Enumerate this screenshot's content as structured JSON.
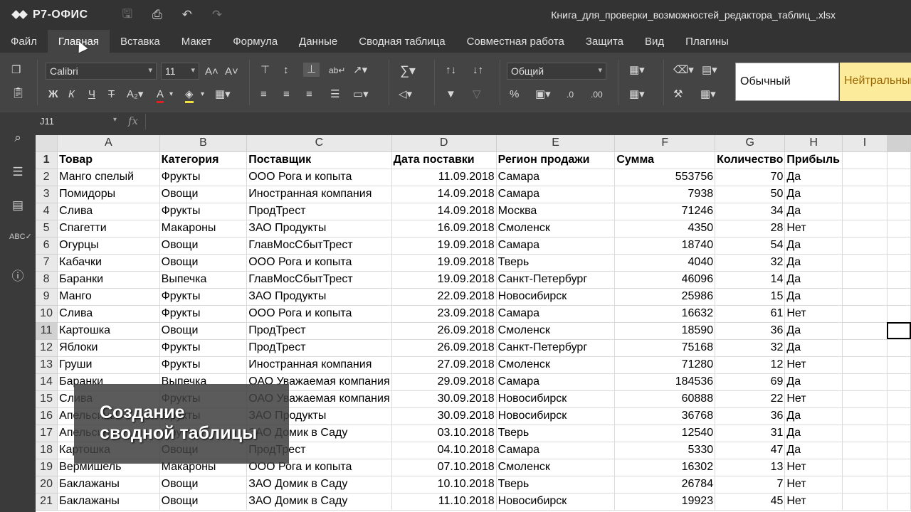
{
  "app": {
    "logo_text": "Р7-ОФИС",
    "document_title": "Книга_для_проверки_возможностей_редактора_таблиц_.xlsx"
  },
  "menu": [
    {
      "label": "Файл"
    },
    {
      "label": "Главная"
    },
    {
      "label": "Вставка"
    },
    {
      "label": "Макет"
    },
    {
      "label": "Формула"
    },
    {
      "label": "Данные"
    },
    {
      "label": "Сводная таблица"
    },
    {
      "label": "Совместная работа"
    },
    {
      "label": "Защита"
    },
    {
      "label": "Вид"
    },
    {
      "label": "Плагины"
    }
  ],
  "toolbar": {
    "font_name": "Calibri",
    "font_size": "11",
    "number_format": "Общий",
    "style_normal": "Обычный",
    "style_neutral": "Нейтральный"
  },
  "formula_bar": {
    "cell_ref": "J11",
    "fx_label": "fx",
    "value": ""
  },
  "grid": {
    "columns": [
      "A",
      "B",
      "C",
      "D",
      "E",
      "F",
      "G",
      "H",
      "I"
    ],
    "rows": [
      {
        "n": "1",
        "cells": [
          "Товар",
          "Категория",
          "Поставщик",
          "Дата поставки",
          "Регион продажи",
          "Сумма",
          "Количество",
          "Прибыль",
          ""
        ]
      },
      {
        "n": "2",
        "cells": [
          "Манго спелый",
          "Фрукты",
          "ООО Рога и копыта",
          "11.09.2018",
          "Самара",
          "553756",
          "70",
          "Да",
          ""
        ]
      },
      {
        "n": "3",
        "cells": [
          "Помидоры",
          "Овощи",
          "Иностранная компания",
          "14.09.2018",
          "Самара",
          "7938",
          "50",
          "Да",
          ""
        ]
      },
      {
        "n": "4",
        "cells": [
          "Слива",
          "Фрукты",
          "ПродТрест",
          "14.09.2018",
          "Москва",
          "71246",
          "34",
          "Да",
          ""
        ]
      },
      {
        "n": "5",
        "cells": [
          "Спагетти",
          "Макароны",
          "ЗАО Продукты",
          "16.09.2018",
          "Смоленск",
          "4350",
          "28",
          "Нет",
          ""
        ]
      },
      {
        "n": "6",
        "cells": [
          "Огурцы",
          "Овощи",
          "ГлавМосСбытТрест",
          "19.09.2018",
          "Самара",
          "18740",
          "54",
          "Да",
          ""
        ]
      },
      {
        "n": "7",
        "cells": [
          "Кабачки",
          "Овощи",
          "ООО Рога и копыта",
          "19.09.2018",
          "Тверь",
          "4040",
          "32",
          "Да",
          ""
        ]
      },
      {
        "n": "8",
        "cells": [
          "Баранки",
          "Выпечка",
          "ГлавМосСбытТрест",
          "19.09.2018",
          "Санкт-Петербург",
          "46096",
          "14",
          "Да",
          ""
        ]
      },
      {
        "n": "9",
        "cells": [
          "Манго",
          "Фрукты",
          "ЗАО Продукты",
          "22.09.2018",
          "Новосибирск",
          "25986",
          "15",
          "Да",
          ""
        ]
      },
      {
        "n": "10",
        "cells": [
          "Слива",
          "Фрукты",
          "ООО Рога и копыта",
          "23.09.2018",
          "Самара",
          "16632",
          "61",
          "Нет",
          ""
        ]
      },
      {
        "n": "11",
        "cells": [
          "Картошка",
          "Овощи",
          "ПродТрест",
          "26.09.2018",
          "Смоленск",
          "18590",
          "36",
          "Да",
          ""
        ]
      },
      {
        "n": "12",
        "cells": [
          "Яблоки",
          "Фрукты",
          "ПродТрест",
          "26.09.2018",
          "Санкт-Петербург",
          "75168",
          "32",
          "Да",
          ""
        ]
      },
      {
        "n": "13",
        "cells": [
          "Груши",
          "Фрукты",
          "Иностранная компания",
          "27.09.2018",
          "Смоленск",
          "71280",
          "12",
          "Нет",
          ""
        ]
      },
      {
        "n": "14",
        "cells": [
          "Баранки",
          "Выпечка",
          "ОАО Уважаемая компания",
          "29.09.2018",
          "Самара",
          "184536",
          "69",
          "Да",
          ""
        ]
      },
      {
        "n": "15",
        "cells": [
          "Слива",
          "Фрукты",
          "ОАО Уважаемая компания",
          "30.09.2018",
          "Новосибирск",
          "60888",
          "22",
          "Нет",
          ""
        ]
      },
      {
        "n": "16",
        "cells": [
          "Апельсины",
          "Фрукты",
          "ЗАО Продукты",
          "30.09.2018",
          "Новосибирск",
          "36768",
          "36",
          "Да",
          ""
        ]
      },
      {
        "n": "17",
        "cells": [
          "Апельсины",
          "Фрукты",
          "ЗАО Домик в Саду",
          "03.10.2018",
          "Тверь",
          "12540",
          "31",
          "Да",
          ""
        ]
      },
      {
        "n": "18",
        "cells": [
          "Картошка",
          "Овощи",
          "ПродТрест",
          "04.10.2018",
          "Самара",
          "5330",
          "47",
          "Да",
          ""
        ]
      },
      {
        "n": "19",
        "cells": [
          "Вермишель",
          "Макароны",
          "ООО Рога и копыта",
          "07.10.2018",
          "Смоленск",
          "16302",
          "13",
          "Нет",
          ""
        ]
      },
      {
        "n": "20",
        "cells": [
          "Баклажаны",
          "Овощи",
          "ЗАО Домик в Саду",
          "10.10.2018",
          "Тверь",
          "26784",
          "7",
          "Нет",
          ""
        ]
      },
      {
        "n": "21",
        "cells": [
          "Баклажаны",
          "Овощи",
          "ЗАО Домик в Саду",
          "11.10.2018",
          "Новосибирск",
          "19923",
          "45",
          "Нет",
          ""
        ]
      }
    ]
  },
  "overlay": {
    "caption_line1": "Создание",
    "caption_line2": "сводной таблицы"
  }
}
